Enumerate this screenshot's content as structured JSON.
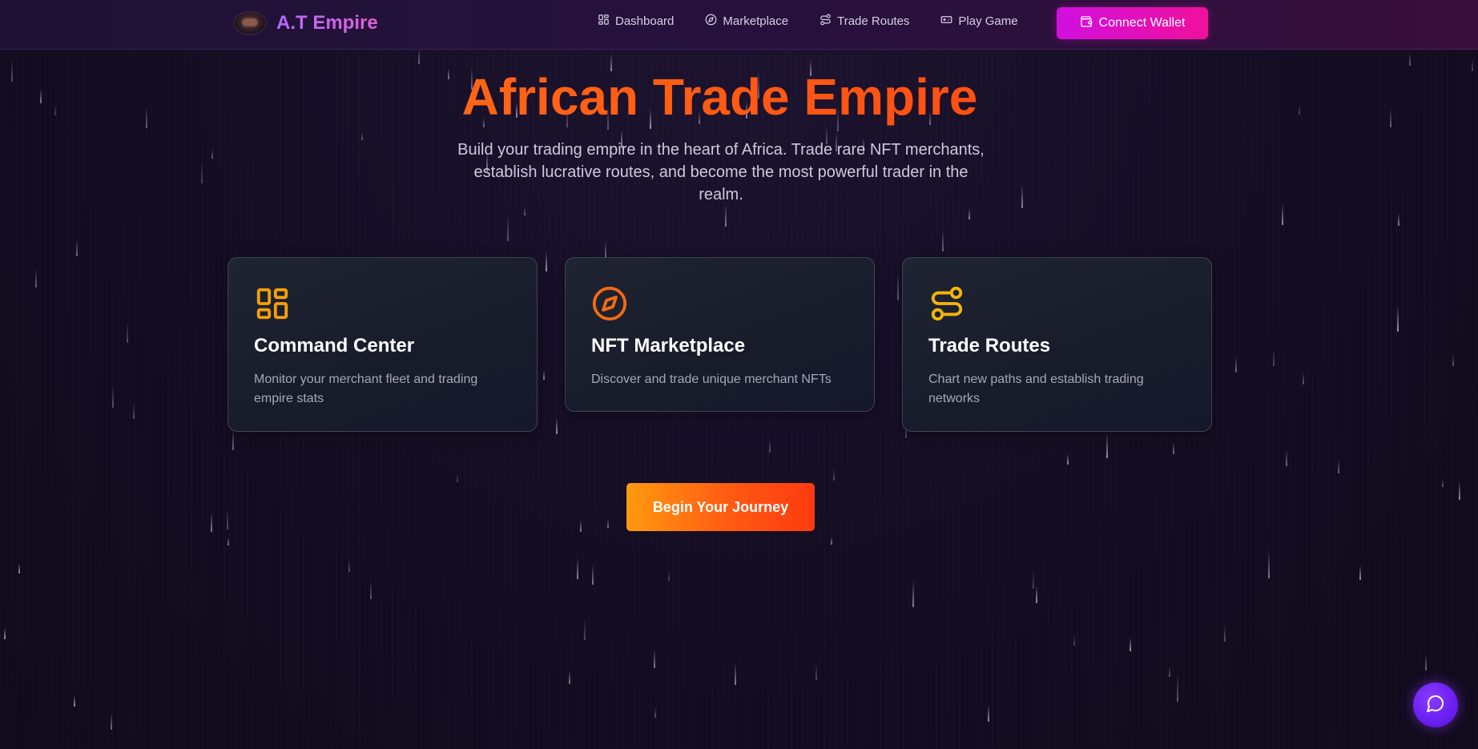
{
  "header": {
    "brand": "A.T Empire",
    "nav": [
      {
        "label": "Dashboard",
        "icon": "dashboard-grid-icon"
      },
      {
        "label": "Marketplace",
        "icon": "compass-icon"
      },
      {
        "label": "Trade Routes",
        "icon": "route-icon"
      },
      {
        "label": "Play Game",
        "icon": "gamepad-icon"
      }
    ],
    "connect_wallet": "Connect Wallet"
  },
  "hero": {
    "title": "African Trade Empire",
    "subtitle": "Build your trading empire in the heart of Africa. Trade rare NFT merchants, establish lucrative routes, and become the most powerful trader in the realm."
  },
  "features": [
    {
      "title": "Command Center",
      "description": "Monitor your merchant fleet and trading empire stats",
      "icon": "dashboard-grid-icon"
    },
    {
      "title": "NFT Marketplace",
      "description": "Discover and trade unique merchant NFTs",
      "icon": "compass-icon"
    },
    {
      "title": "Trade Routes",
      "description": "Chart new paths and establish trading networks",
      "icon": "route-icon"
    }
  ],
  "cta": {
    "label": "Begin Your Journey"
  },
  "chat": {
    "icon": "chat-bubble-icon"
  },
  "colors": {
    "accent_orange": "#ff5a14",
    "accent_magenta": "#e010c8",
    "icon_amber": "#f59e0b",
    "background": "#130c1f"
  }
}
